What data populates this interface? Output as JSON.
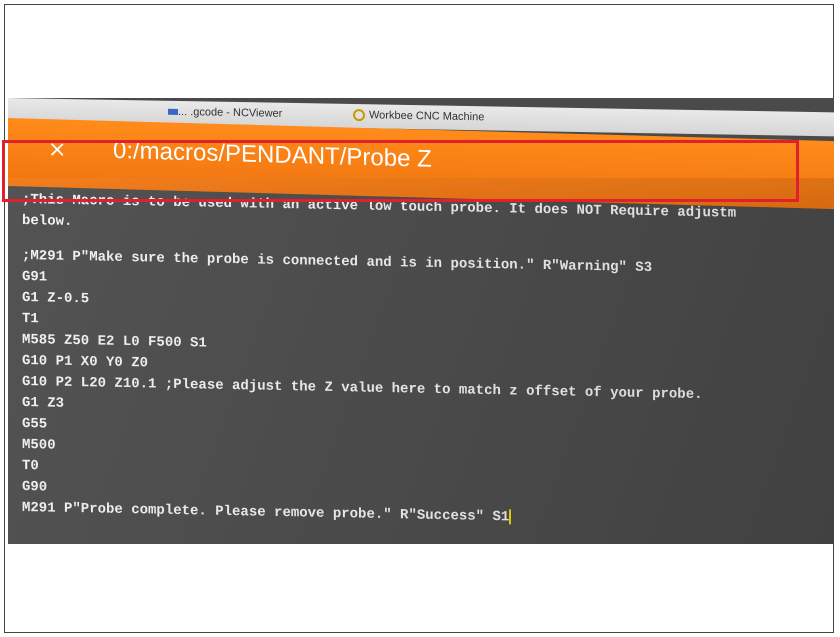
{
  "browser": {
    "tabs": [
      {
        "label": "... .gcode - NCViewer"
      },
      {
        "label": "Workbee CNC Machine"
      }
    ]
  },
  "header": {
    "close_icon": "×",
    "title": "0:/macros/PENDANT/Probe Z",
    "accent_color": "#f07410"
  },
  "editor": {
    "lines_top": [
      ";This Macro is to be used with an active low touch probe. It does NOT Require adjustm",
      "below."
    ],
    "highlighted_lines": [
      ";M291 P\"Make sure the probe is connected and is in position.\" R\"Warning\" S3",
      "G91"
    ],
    "lines_rest": [
      "G1 Z-0.5",
      "T1",
      "M585 Z50 E2 L0 F500 S1",
      "G10 P1 X0 Y0 Z0",
      "G10 P2 L20 Z10.1 ;Please adjust the Z value here to match z offset of your probe.",
      "G1 Z3",
      "G55",
      "M500",
      "T0",
      "G90",
      "M291 P\"Probe complete. Please remove probe.\" R\"Success\" S1"
    ],
    "highlight_color": "#e0202a"
  }
}
